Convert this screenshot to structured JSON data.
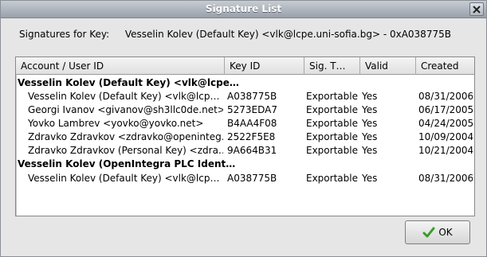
{
  "window": {
    "title": "Signature List"
  },
  "key_info": {
    "prefix": "Signatures for Key:",
    "value": "Vesselin Kolev (Default Key) <vlk@lcpe.uni-sofia.bg> - 0xA038775B"
  },
  "columns": [
    "Account / User ID",
    "Key ID",
    "Sig. T…",
    "Valid",
    "Created"
  ],
  "rows": [
    {
      "type": "group",
      "account": "Vesselin Kolev (Default Key) <vlk@lcpe…"
    },
    {
      "type": "item",
      "account": "Vesselin Kolev (Default Key) <vlk@lcp…",
      "key_id": "A038775B",
      "sig_type": "Exportable",
      "valid": "Yes",
      "created": "08/31/2006"
    },
    {
      "type": "item",
      "account": "Georgi Ivanov <givanov@sh3llc0de.net>",
      "key_id": "5273EDA7",
      "sig_type": "Exportable",
      "valid": "Yes",
      "created": "06/17/2005"
    },
    {
      "type": "item",
      "account": "Yovko Lambrev <yovko@yovko.net>",
      "key_id": "B4AA4F08",
      "sig_type": "Exportable",
      "valid": "Yes",
      "created": "04/24/2005"
    },
    {
      "type": "item",
      "account": "Zdravko Zdravkov <zdravko@openinteg…",
      "key_id": "2522F5E8",
      "sig_type": "Exportable",
      "valid": "Yes",
      "created": "10/09/2004"
    },
    {
      "type": "item",
      "account": "Zdravko Zdravkov (Personal Key) <zdra…",
      "key_id": "9A664B31",
      "sig_type": "Exportable",
      "valid": "Yes",
      "created": "10/21/2004"
    },
    {
      "type": "group",
      "account": "Vesselin Kolev (OpenIntegra PLC Ident…"
    },
    {
      "type": "item",
      "account": "Vesselin Kolev (Default Key) <vlk@lcp…",
      "key_id": "A038775B",
      "sig_type": "Exportable",
      "valid": "Yes",
      "created": "08/31/2006"
    }
  ],
  "ok_button": {
    "label": "OK",
    "icon": "checkmark-icon"
  },
  "colors": {
    "titlebar": "#9aa1ab",
    "check": "#3a9b2a"
  }
}
